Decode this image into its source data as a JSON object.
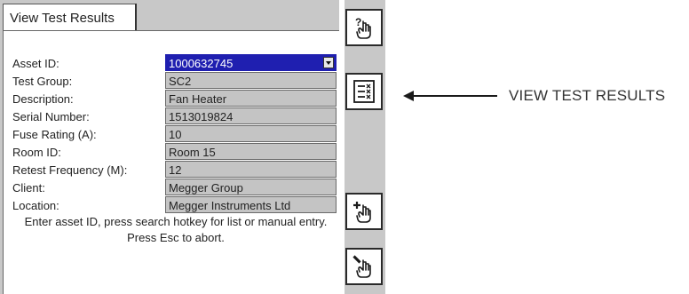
{
  "tab": {
    "label": "View Test Results"
  },
  "form": {
    "fields": [
      {
        "label": "Asset ID:",
        "value": "1000632745",
        "selected": true
      },
      {
        "label": "Test Group:",
        "value": "SC2"
      },
      {
        "label": "Description:",
        "value": "Fan Heater"
      },
      {
        "label": "Serial Number:",
        "value": "1513019824"
      },
      {
        "label": "Fuse Rating (A):",
        "value": "10"
      },
      {
        "label": "Room ID:",
        "value": "Room 15"
      },
      {
        "label": "Retest Frequency (M):",
        "value": "12"
      },
      {
        "label": "Client:",
        "value": "Megger Group"
      },
      {
        "label": "Location:",
        "value": "Megger Instruments Ltd"
      }
    ],
    "hint": "Enter asset ID, press search hotkey for list or manual entry. Press Esc to abort."
  },
  "hotkeys": [
    {
      "icon": "help-hand-icon"
    },
    {
      "icon": "view-test-results-icon"
    },
    {
      "icon": "add-hand-icon"
    },
    {
      "icon": "edit-hand-icon"
    }
  ],
  "annotation": {
    "label": "VIEW TEST RESULTS"
  },
  "colors": {
    "selection": "#1f1fb0",
    "field_bg": "#c4c4c4",
    "screen_bg": "#c8c8c8"
  }
}
